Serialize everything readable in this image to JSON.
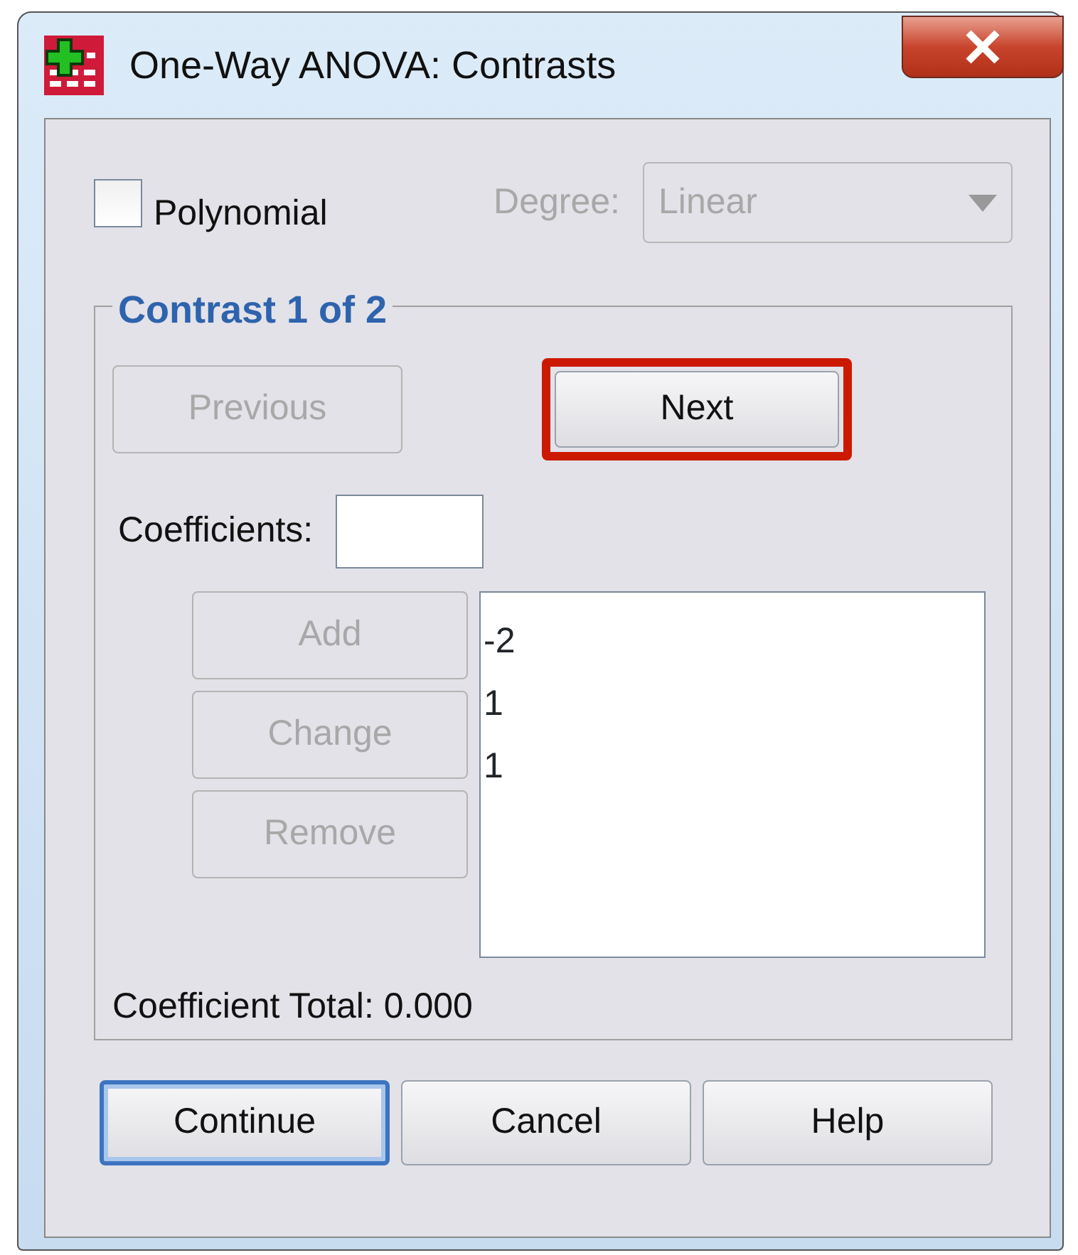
{
  "window": {
    "title": "One-Way ANOVA: Contrasts"
  },
  "polynomial": {
    "label": "Polynomial",
    "checked": false
  },
  "degree": {
    "label": "Degree:",
    "value": "Linear",
    "disabled": true
  },
  "contrast_group": {
    "title": "Contrast 1 of 2",
    "previous_button": {
      "label": "Previous",
      "disabled": true
    },
    "next_button": {
      "label": "Next",
      "disabled": false,
      "highlighted": true
    },
    "coefficients": {
      "label": "Coefficients:"
    },
    "list_buttons": [
      {
        "label": "Add",
        "disabled": true
      },
      {
        "label": "Change",
        "disabled": true
      },
      {
        "label": "Remove",
        "disabled": true
      }
    ],
    "coefficient_list": [
      "-2",
      "1",
      "1"
    ],
    "total": {
      "label": "Coefficient Total:",
      "value": "0.000"
    }
  },
  "buttons": [
    {
      "label": "Continue",
      "default": true
    },
    {
      "label": "Cancel",
      "default": false
    },
    {
      "label": "Help",
      "default": false
    }
  ]
}
